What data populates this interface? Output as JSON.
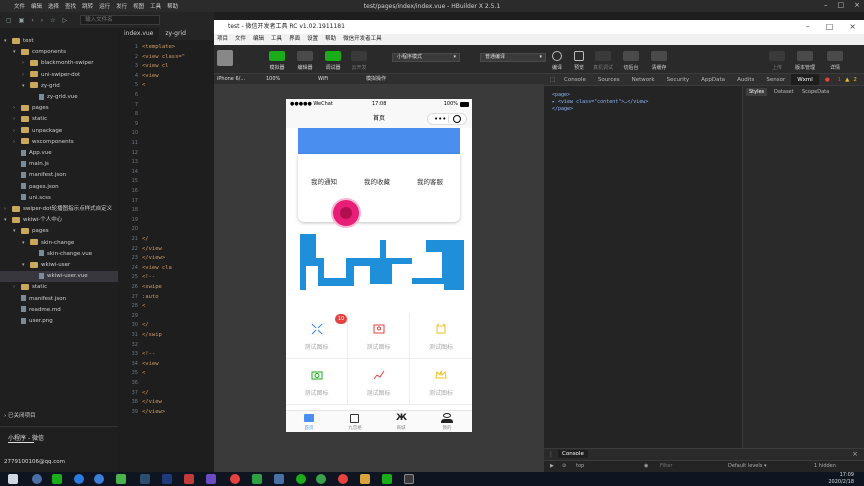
{
  "hbuilder": {
    "menu": [
      "文件",
      "编辑",
      "选择",
      "查找",
      "跳转",
      "运行",
      "发行",
      "视图",
      "工具",
      "帮助"
    ],
    "title": "test/pages/index/index.vue - HBuilder X 2.5.1",
    "search_placeholder": "输入文件名"
  },
  "tree": {
    "rows": [
      {
        "label": "test",
        "indent": 0,
        "kind": "folder",
        "open": true
      },
      {
        "label": "components",
        "indent": 1,
        "kind": "folder",
        "open": true
      },
      {
        "label": "blackmonth-swiper",
        "indent": 2,
        "kind": "folder",
        "open": false
      },
      {
        "label": "uni-swiper-dot",
        "indent": 2,
        "kind": "folder",
        "open": false
      },
      {
        "label": "zy-grid",
        "indent": 2,
        "kind": "folder",
        "open": true
      },
      {
        "label": "zy-grid.vue",
        "indent": 3,
        "kind": "file",
        "open": false
      },
      {
        "label": "pages",
        "indent": 1,
        "kind": "folder",
        "open": false
      },
      {
        "label": "static",
        "indent": 1,
        "kind": "folder",
        "open": false
      },
      {
        "label": "unpackage",
        "indent": 1,
        "kind": "folder",
        "open": false
      },
      {
        "label": "wxcomponents",
        "indent": 1,
        "kind": "folder",
        "open": false
      },
      {
        "label": "App.vue",
        "indent": 1,
        "kind": "file",
        "open": false
      },
      {
        "label": "main.js",
        "indent": 1,
        "kind": "file",
        "open": false
      },
      {
        "label": "manifest.json",
        "indent": 1,
        "kind": "file",
        "open": false
      },
      {
        "label": "pages.json",
        "indent": 1,
        "kind": "file",
        "open": false
      },
      {
        "label": "uni.scss",
        "indent": 1,
        "kind": "file",
        "open": false
      },
      {
        "label": "swiper-dot轮播图指示点样式自定义",
        "indent": 0,
        "kind": "folder",
        "open": false
      },
      {
        "label": "wkiwi-个人中心",
        "indent": 0,
        "kind": "folder",
        "open": true
      },
      {
        "label": "pages",
        "indent": 1,
        "kind": "folder",
        "open": true
      },
      {
        "label": "skin-change",
        "indent": 2,
        "kind": "folder",
        "open": true
      },
      {
        "label": "skin-change.vue",
        "indent": 3,
        "kind": "file",
        "open": false
      },
      {
        "label": "wkiwi-user",
        "indent": 2,
        "kind": "folder",
        "open": true
      },
      {
        "label": "wkiwi-user.vue",
        "indent": 3,
        "kind": "file",
        "open": false,
        "selected": true
      },
      {
        "label": "static",
        "indent": 1,
        "kind": "folder",
        "open": false
      },
      {
        "label": "manifest.json",
        "indent": 1,
        "kind": "file",
        "open": false
      },
      {
        "label": "readme.md",
        "indent": 1,
        "kind": "file",
        "open": false
      },
      {
        "label": "user.png",
        "indent": 1,
        "kind": "file",
        "open": false
      }
    ],
    "closed_projects": "已关闭项目",
    "footer_tab": "小程序 - 微信",
    "account": "2779100106@qq.com"
  },
  "editor": {
    "tabs": [
      "index.vue",
      "zy-grid"
    ],
    "line_numbers": [
      "1",
      "2",
      "3",
      "4",
      "5",
      "6",
      "7",
      "8",
      "9",
      "10",
      "11",
      "12",
      "13",
      "14",
      "15",
      "16",
      "17",
      "18",
      "19",
      "20",
      "21",
      "22",
      "23",
      "24",
      "25",
      "26",
      "27",
      "28",
      "29",
      "30",
      "31",
      "32",
      "33",
      "34",
      "35",
      "36",
      "37",
      "38",
      "39"
    ],
    "code": [
      "<template>",
      "  <view class=\"",
      "    <view cl",
      "      <view",
      "        <",
      "",
      "",
      "",
      "",
      "",
      "",
      "",
      "",
      "",
      "",
      "",
      "",
      "",
      "",
      "",
      "      </",
      "    </view",
      "  </view>",
      "  <view cla",
      "    <!-- ",
      "    <swipe",
      "      :auto",
      "        <",
      "",
      "      </",
      "    </swip",
      "",
      "    <!-- ",
      "    <view",
      "      <",
      "",
      "      </",
      "    </view",
      "  </view>"
    ]
  },
  "devtools": {
    "title": "test - 微信开发者工具 RC v1.02.1911181",
    "menu": [
      "项目",
      "文件",
      "编辑",
      "工具",
      "界面",
      "设置",
      "帮助",
      "微信开发者工具"
    ],
    "toolbar": {
      "simulator": "模拟器",
      "editor": "编辑器",
      "debugger": "调试器",
      "cloud": "云开发",
      "mode": "小程序模式",
      "compile": "普通编译",
      "compile_btn": "编译",
      "preview": "预览",
      "real_debug": "真机调试",
      "background": "切后台",
      "clear_cache": "清缓存",
      "upload": "上传",
      "version": "版本管理",
      "details": "详情"
    },
    "sim_bar": {
      "device": "iPhone 6/...",
      "zoom": "100%",
      "network": "WiFi",
      "action": "模拟操作"
    },
    "panel_tabs": [
      "Console",
      "Sources",
      "Network",
      "Security",
      "AppData",
      "Audits",
      "Sensor",
      "Wxml"
    ],
    "error_count": "1",
    "warn_count": "2",
    "dom_lines": [
      "<page>",
      "  ▸ <view class=\"content\">…</view>",
      "</page>"
    ],
    "style_tabs": [
      "Styles",
      "Dataset",
      "ScopeData"
    ],
    "console_tab": "Console",
    "console_context": "top",
    "console_filter": "Filter",
    "console_levels": "Default levels ▾",
    "console_hidden": "1 hidden"
  },
  "phone": {
    "status_carrier": "●●●●● WeChat",
    "status_time": "17:08",
    "status_battery": "100%",
    "nav_title": "首页",
    "card_links": [
      "我的通知",
      "我的收藏",
      "我的客服"
    ],
    "grid_labels": [
      "测试图标",
      "测试图标",
      "测试图标",
      "测试图标",
      "测试图标",
      "测试图标"
    ],
    "badge": "10",
    "tabs": [
      "首页",
      "九宫格",
      "商城",
      "我的"
    ]
  },
  "taskbar": {
    "time": "17:09",
    "date": "2020/2/18"
  },
  "colors": {
    "accent_blue": "#4a8ef0",
    "pink": "#e91e78",
    "swiper_blue": "#1e8fd8",
    "badge_red": "#e64340"
  }
}
